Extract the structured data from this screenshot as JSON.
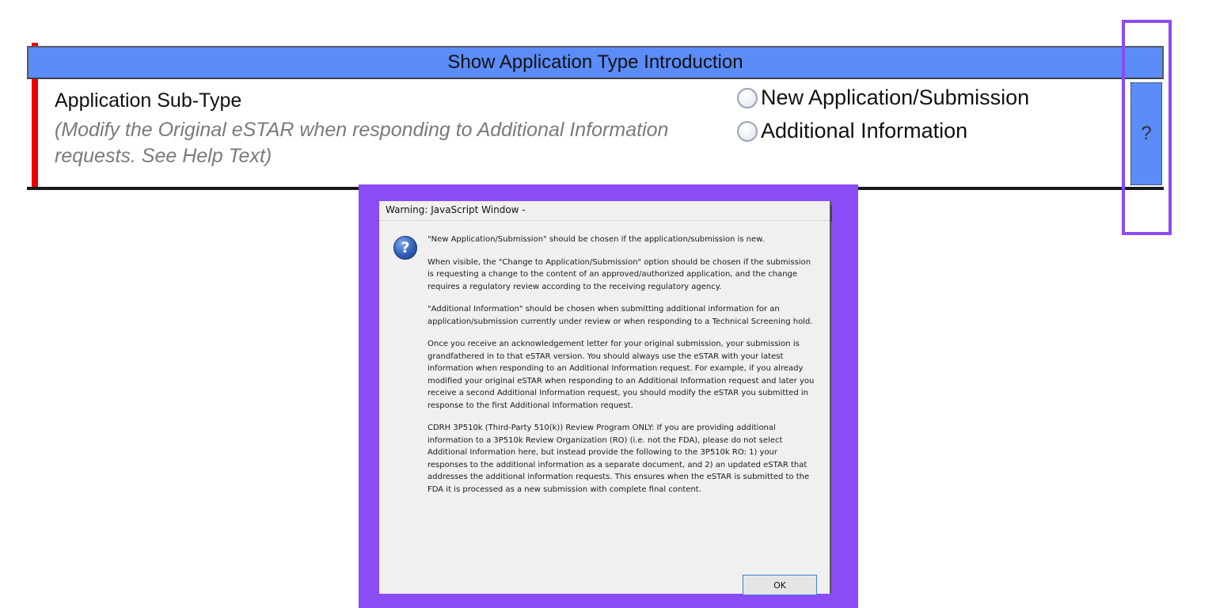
{
  "form": {
    "header_title": "Show Application Type Introduction",
    "subtype_label": "Application Sub-Type",
    "subtype_note": "(Modify the Original eSTAR when responding to Additional Information requests. See Help Text)",
    "radio_options": [
      {
        "label": "New Application/Submission",
        "selected": false
      },
      {
        "label": "Additional Information",
        "selected": false
      }
    ],
    "help_button_label": "?"
  },
  "dialog": {
    "title": "Warning: JavaScript Window -",
    "icon": "question-icon",
    "paragraphs": [
      "\"New Application/Submission\" should be chosen if the application/submission is new.",
      "When visible, the \"Change to Application/Submission\" option should be chosen if the submission is requesting a change to the content of an approved/authorized application, and the change requires a regulatory review according to the receiving regulatory agency.",
      "\"Additional Information\" should be chosen when submitting additional information for an application/submission currently under review or when responding to a Technical Screening hold.",
      "Once you receive an acknowledgement letter for your original submission, your submission is grandfathered in to that eSTAR version. You should always use the eSTAR with your latest information when responding to an Additional Information request. For example, if you already modified your original eSTAR when responding to an Additional Information request and later you receive a second Additional Information request, you should modify the eSTAR you submitted in response to the first Additional Information request.",
      "CDRH 3P510k (Third-Party 510(k)) Review Program ONLY: If you are providing additional information to a 3P510k Review Organization (RO) (i.e. not the FDA), please do not select Additional Information here, but instead provide the following to the 3P510k RO: 1) your responses to the additional information as a separate document, and 2) an updated eSTAR that addresses the additional information requests. This ensures when the eSTAR is submitted to the FDA it is processed as a new submission with complete final content."
    ],
    "ok_label": "OK"
  },
  "colors": {
    "header_blue": "#5b8cf7",
    "marker_red": "#ee0000",
    "highlight_purple": "#8a4cf5"
  }
}
